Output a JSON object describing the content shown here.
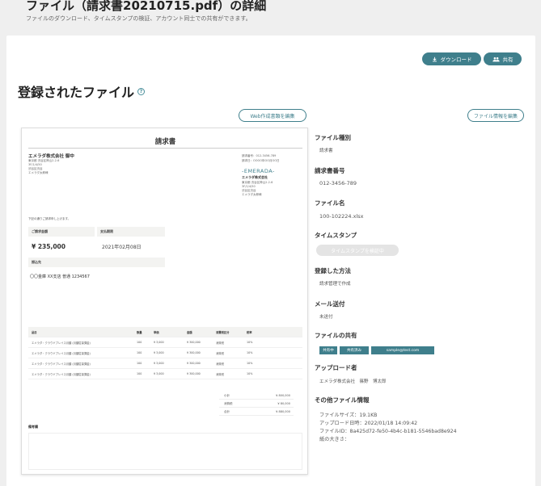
{
  "page": {
    "title": "ファイル（請求書20210715.pdf）の詳細",
    "subtitle": "ファイルのダウンロード、タイムスタンプの検証、アカウント同士での共有ができます。"
  },
  "actions": {
    "download_label": "ダウンロード",
    "share_label": "共有",
    "web_edit_label": "Web作成書類を編集",
    "file_edit_label": "ファイル情報を編集"
  },
  "section": {
    "title": "登録されたファイル"
  },
  "invoice": {
    "title": "請求書",
    "to": "エメラダ株式会社 御中",
    "to_address": [
      "東京都 渋谷区神山2-2-6",
      "3F/1/4/50",
      "渋谷区渋谷",
      "エメラダ太郎様"
    ],
    "meta": [
      "請求番号：012-3456-789",
      "請求日：OOOO年OO月OO日"
    ],
    "logo": "-EMERADA-",
    "company": "エメラダ株式会社",
    "company_address": [
      "東京都 渋谷区神山2-2-6",
      "3F/1/4/50",
      "渋谷区渋谷",
      "エメラダ太郎様"
    ],
    "lead": "下記の通りご請求申し上げます。",
    "amount_label": "ご請求金額",
    "amount": "¥ 235,000",
    "due_label": "支払期限",
    "due": "2021年02月08日",
    "bank_label": "振込先",
    "bank": "〇〇金庫 XX支店 普通 1234567",
    "table_header": [
      "品目",
      "数量",
      "単価",
      "金額",
      "消費税区分",
      "税率"
    ],
    "rows": [
      [
        "エメラダ・クラウドプレイス月額 (月額従量課金)",
        "100",
        "¥ 3,000",
        "¥ 300,000",
        "消費税",
        "10%"
      ],
      [
        "エメラダ・クラウドプレイス月額 (月額従量課金)",
        "100",
        "¥ 3,000",
        "¥ 300,000",
        "消費税",
        "10%"
      ],
      [
        "エメラダ・クラウドプレイス月額 (月額従量課金)",
        "100",
        "¥ 3,000",
        "¥ 300,000",
        "消費税",
        "10%"
      ],
      [
        "エメラダ・クラウドプレイス月額 (月額従量課金)",
        "100",
        "¥ 3,000",
        "¥ 300,000",
        "消費税",
        "10%"
      ]
    ],
    "totals": [
      {
        "label": "小計",
        "value": "¥ 800,000"
      },
      {
        "label": "消費税",
        "value": "¥ 80,000"
      },
      {
        "label": "合計",
        "value": "¥ 880,000"
      }
    ],
    "notes_label": "備考欄"
  },
  "details": {
    "type_label": "ファイル種別",
    "type_value": "請求書",
    "number_label": "請求書番号",
    "number_value": "012-3456-789",
    "name_label": "ファイル名",
    "name_value": "100-102224.xlsx",
    "timestamp_label": "タイムスタンプ",
    "timestamp_button": "タイムスタンプを検証中",
    "method_label": "登録した方法",
    "method_value": "請求管理で作成",
    "mail_label": "メール送付",
    "mail_value": "未送付",
    "share_label": "ファイルの共有",
    "share_tags": [
      "共有中",
      "共有済み",
      "sample@test.com"
    ],
    "uploader_label": "アップロード者",
    "uploader_value": "エメラダ株式会社　篠野　博太郎",
    "other_label": "その他ファイル情報",
    "other_lines": [
      "ファイルサイズ：19.1KB",
      "アップロード日時：2022/01/18 14:09:42",
      "ファイルID：8a425d72-fe50-4b4c-b181-5546bad8e924",
      "紙の大きさ："
    ]
  }
}
